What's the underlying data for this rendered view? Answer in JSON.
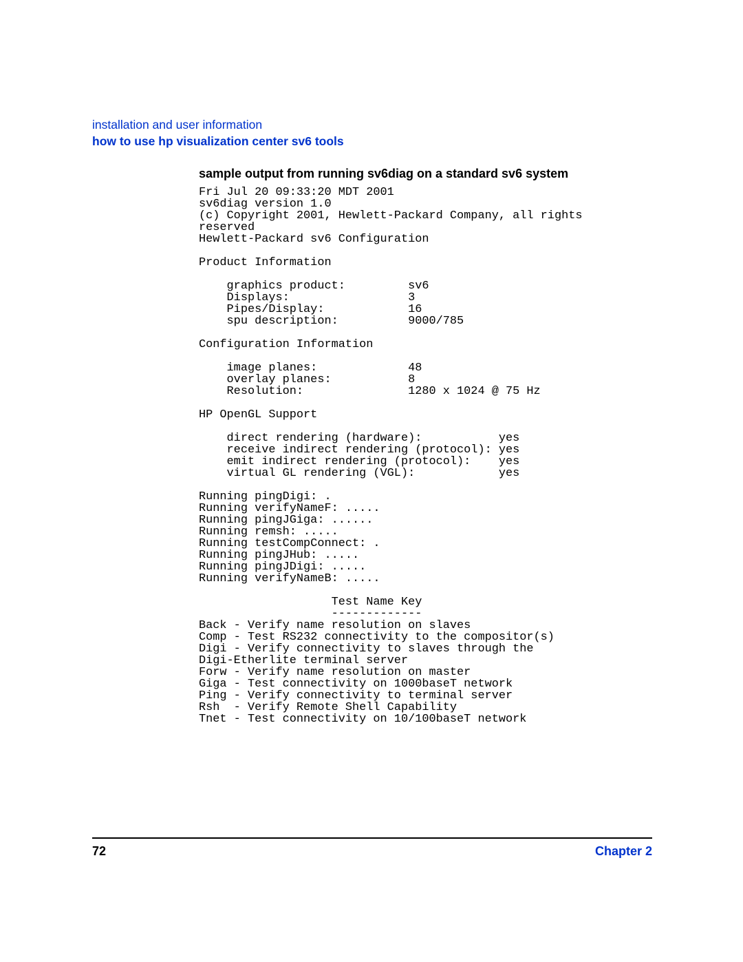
{
  "header": {
    "section": "installation and user information",
    "subsection": "how to use hp visualization center sv6 tools"
  },
  "content": {
    "subheading": "sample output from running sv6diag on a standard sv6 system",
    "mono": "Fri Jul 20 09:33:20 MDT 2001\nsv6diag version 1.0\n(c) Copyright 2001, Hewlett-Packard Company, all rights\nreserved\nHewlett-Packard sv6 Configuration\n\nProduct Information\n\n    graphics product:         sv6\n    Displays:                 3\n    Pipes/Display:            16\n    spu description:          9000/785\n\nConfiguration Information\n\n    image planes:             48\n    overlay planes:           8\n    Resolution:               1280 x 1024 @ 75 Hz\n\nHP OpenGL Support\n\n    direct rendering (hardware):           yes\n    receive indirect rendering (protocol): yes\n    emit indirect rendering (protocol):    yes\n    virtual GL rendering (VGL):            yes\n\nRunning pingDigi: .\nRunning verifyNameF: .....\nRunning pingJGiga: ......\nRunning remsh: .....\nRunning testCompConnect: .\nRunning pingJHub: .....\nRunning pingJDigi: .....\nRunning verifyNameB: .....\n\n                   Test Name Key\n                   -------------\nBack - Verify name resolution on slaves\nComp - Test RS232 connectivity to the compositor(s)\nDigi - Verify connectivity to slaves through the\nDigi-Etherlite terminal server\nForw - Verify name resolution on master\nGiga - Test connectivity on 1000baseT network\nPing - Verify connectivity to terminal server\nRsh  - Verify Remote Shell Capability\nTnet - Test connectivity on 10/100baseT network"
  },
  "footer": {
    "page_number": "72",
    "chapter": "Chapter 2"
  }
}
